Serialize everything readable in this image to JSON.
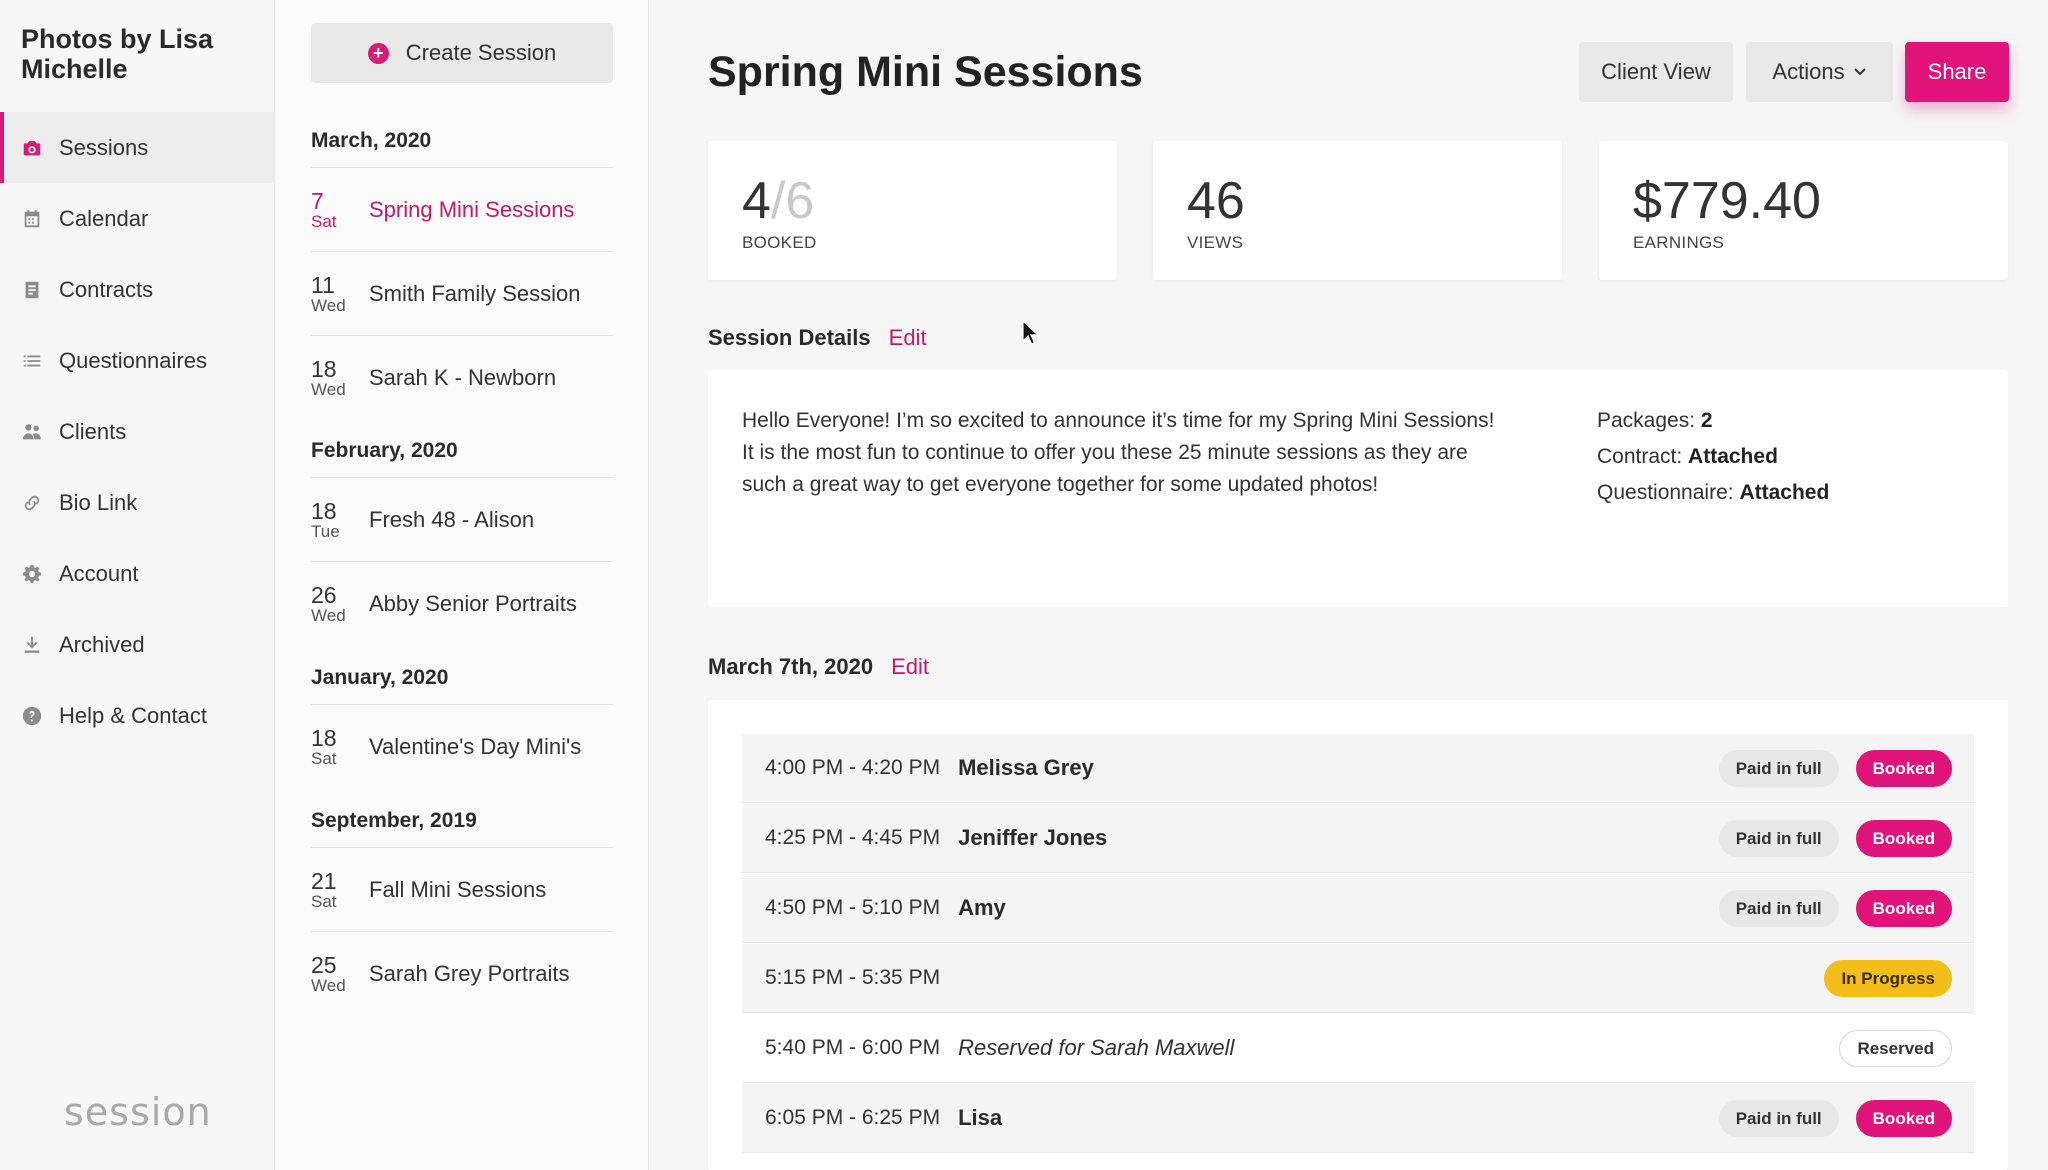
{
  "brand": "Photos by Lisa Michelle",
  "sidebar": {
    "items": [
      {
        "label": "Sessions",
        "icon": "camera-icon",
        "active": true
      },
      {
        "label": "Calendar",
        "icon": "calendar-icon"
      },
      {
        "label": "Contracts",
        "icon": "document-icon"
      },
      {
        "label": "Questionnaires",
        "icon": "list-icon"
      },
      {
        "label": "Clients",
        "icon": "users-icon"
      },
      {
        "label": "Bio Link",
        "icon": "link-icon"
      },
      {
        "label": "Account",
        "icon": "gear-icon"
      },
      {
        "label": "Archived",
        "icon": "download-icon"
      },
      {
        "label": "Help & Contact",
        "icon": "help-icon"
      }
    ],
    "footer_logo": "session"
  },
  "session_list": {
    "create_label": "Create Session",
    "groups": [
      {
        "month": "March, 2020",
        "sessions": [
          {
            "day": "7",
            "weekday": "Sat",
            "name": "Spring Mini Sessions",
            "active": true
          },
          {
            "day": "11",
            "weekday": "Wed",
            "name": "Smith Family Session"
          },
          {
            "day": "18",
            "weekday": "Wed",
            "name": "Sarah K - Newborn"
          }
        ]
      },
      {
        "month": "February, 2020",
        "sessions": [
          {
            "day": "18",
            "weekday": "Tue",
            "name": "Fresh 48 - Alison"
          },
          {
            "day": "26",
            "weekday": "Wed",
            "name": "Abby Senior Portraits"
          }
        ]
      },
      {
        "month": "January, 2020",
        "sessions": [
          {
            "day": "18",
            "weekday": "Sat",
            "name": "Valentine's Day Mini's"
          }
        ]
      },
      {
        "month": "September, 2019",
        "sessions": [
          {
            "day": "21",
            "weekday": "Sat",
            "name": "Fall Mini Sessions"
          },
          {
            "day": "25",
            "weekday": "Wed",
            "name": "Sarah Grey Portraits"
          }
        ]
      }
    ]
  },
  "main": {
    "title": "Spring Mini Sessions",
    "buttons": {
      "client_view": "Client View",
      "actions": "Actions",
      "share": "Share"
    },
    "stats": {
      "booked_value": "4",
      "booked_total": "/6",
      "booked_label": "BOOKED",
      "views_value": "46",
      "views_label": "VIEWS",
      "earnings_value": "$779.40",
      "earnings_label": "EARNINGS"
    },
    "details": {
      "heading": "Session Details",
      "edit": "Edit",
      "text": "Hello Everyone! I’m so excited to announce it’s time for my Spring Mini Sessions! It is the most fun to continue to offer you these 25 minute sessions as they are such a great way to get everyone together for some updated photos!",
      "packages_label": "Packages:",
      "packages_value": "2",
      "contract_label": "Contract:",
      "contract_value": "Attached",
      "questionnaire_label": "Questionnaire:",
      "questionnaire_value": "Attached"
    },
    "schedule": {
      "heading": "March 7th, 2020",
      "edit": "Edit",
      "slots": [
        {
          "time": "4:00 PM - 4:20 PM",
          "name": "Melissa Grey",
          "payment": "Paid in full",
          "status": "Booked"
        },
        {
          "time": "4:25 PM - 4:45 PM",
          "name": "Jeniffer Jones",
          "payment": "Paid in full",
          "status": "Booked"
        },
        {
          "time": "4:50 PM - 5:10 PM",
          "name": "Amy",
          "payment": "Paid in full",
          "status": "Booked"
        },
        {
          "time": "5:15 PM - 5:35 PM",
          "name": "",
          "payment": "",
          "status": "In Progress"
        },
        {
          "time": "5:40 PM - 6:00 PM",
          "name": "Reserved for Sarah Maxwell",
          "payment": "",
          "status": "Reserved"
        },
        {
          "time": "6:05 PM - 6:25 PM",
          "name": "Lisa",
          "payment": "Paid in full",
          "status": "Booked"
        }
      ]
    }
  },
  "colors": {
    "accent": "#e0137b",
    "accent_text": "#c2186f",
    "in_progress": "#f5bd19"
  }
}
